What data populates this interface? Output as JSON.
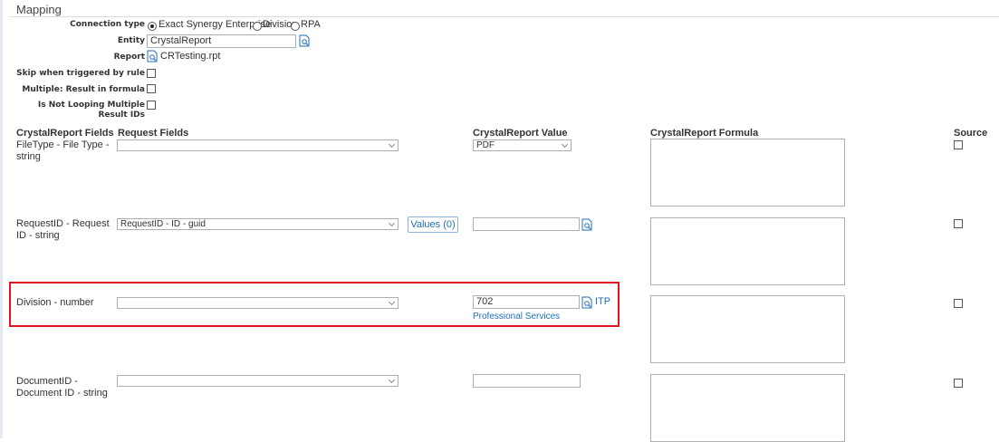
{
  "section": {
    "title": "Mapping"
  },
  "form": {
    "connection_type_label": "Connection type",
    "connection_options": [
      "Exact Synergy Enterprise",
      "Division",
      "RPA"
    ],
    "connection_selected": "Exact Synergy Enterprise",
    "entity_label": "Entity",
    "entity_value": "CrystalReport",
    "report_label": "Report",
    "report_file": "CRTesting.rpt",
    "skip_label": "Skip when triggered by rule",
    "multiple_label": "Multiple: Result in formula",
    "not_looping_label": "Is Not Looping Multiple Result IDs"
  },
  "table": {
    "headers": {
      "fields": "CrystalReport Fields",
      "request": "Request Fields",
      "value": "CrystalReport Value",
      "formula": "CrystalReport Formula",
      "source": "Source"
    },
    "rows": [
      {
        "field": "FileType - File Type - string",
        "request_value": "",
        "value": "PDF"
      },
      {
        "field": "RequestID - Request ID - string",
        "request_value": "RequestID - ID - guid",
        "values_button": "Values (0)",
        "value": ""
      },
      {
        "field": "Division - number",
        "request_value": "",
        "value": "702",
        "lookup_code": "ITP",
        "lookup_desc": "Professional Services"
      },
      {
        "field": "DocumentID - Document ID - string",
        "request_value": "",
        "value": ""
      }
    ]
  },
  "colors": {
    "link": "#1f6fb5",
    "highlight": "#e0141e",
    "border": "#a8b0bc"
  },
  "icons": [
    "lookup-icon",
    "document-icon",
    "chevron-down-icon"
  ]
}
